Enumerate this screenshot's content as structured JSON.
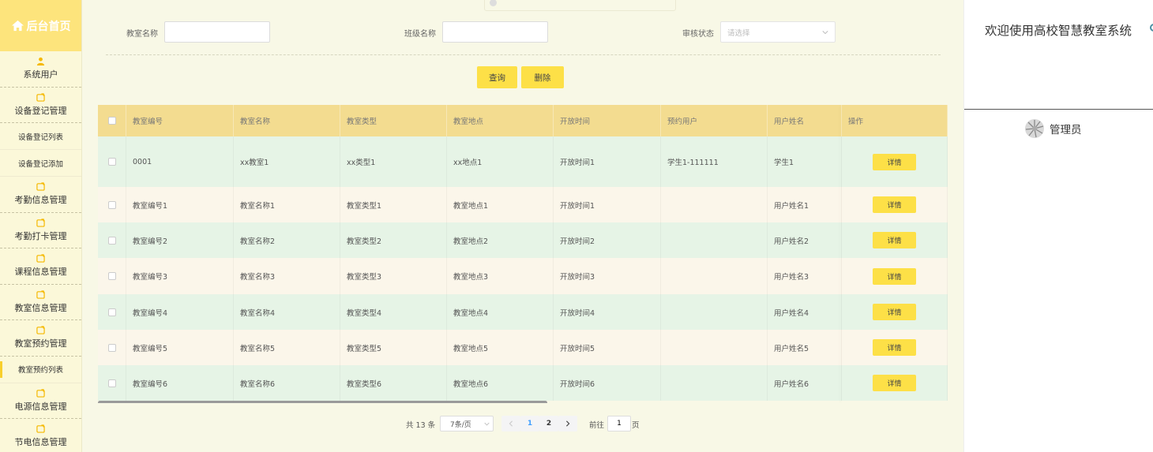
{
  "sidebar": {
    "home_label": "后台首页",
    "items": [
      {
        "label": "系统用户",
        "icon": "user-icon"
      },
      {
        "label": "设备登记管理",
        "icon": "folder-icon"
      },
      {
        "label": "设备登记列表",
        "sub": true
      },
      {
        "label": "设备登记添加",
        "sub": true
      },
      {
        "label": "考勤信息管理",
        "icon": "folder-icon"
      },
      {
        "label": "考勤打卡管理",
        "icon": "folder-icon"
      },
      {
        "label": "课程信息管理",
        "icon": "folder-icon"
      },
      {
        "label": "教室信息管理",
        "icon": "folder-icon"
      },
      {
        "label": "教室预约管理",
        "icon": "folder-icon"
      },
      {
        "label": "教室预约列表",
        "sub": true,
        "active": true
      },
      {
        "label": "电源信息管理",
        "icon": "folder-icon"
      },
      {
        "label": "节电信息管理",
        "icon": "folder-icon"
      }
    ]
  },
  "search": {
    "classroom_label": "教室名称",
    "classroom_value": "",
    "class_label": "班级名称",
    "class_value": "",
    "status_label": "审核状态",
    "status_placeholder": "请选择",
    "query_btn": "查询",
    "delete_btn": "删除"
  },
  "table": {
    "headers": [
      "教室编号",
      "教室名称",
      "教室类型",
      "教室地点",
      "开放时间",
      "预约用户",
      "用户姓名",
      "操作"
    ],
    "detail_label": "详情",
    "rows": [
      [
        "0001",
        "xx教室1",
        "xx类型1",
        "xx地点1",
        "开放时间1",
        "学生1-111111",
        "学生1"
      ],
      [
        "教室编号1",
        "教室名称1",
        "教室类型1",
        "教室地点1",
        "开放时间1",
        "",
        "用户姓名1"
      ],
      [
        "教室编号2",
        "教室名称2",
        "教室类型2",
        "教室地点2",
        "开放时间2",
        "",
        "用户姓名2"
      ],
      [
        "教室编号3",
        "教室名称3",
        "教室类型3",
        "教室地点3",
        "开放时间3",
        "",
        "用户姓名3"
      ],
      [
        "教室编号4",
        "教室名称4",
        "教室类型4",
        "教室地点4",
        "开放时间4",
        "",
        "用户姓名4"
      ],
      [
        "教室编号5",
        "教室名称5",
        "教室类型5",
        "教室地点5",
        "开放时间5",
        "",
        "用户姓名5"
      ],
      [
        "教室编号6",
        "教室名称6",
        "教室类型6",
        "教室地点6",
        "开放时间6",
        "",
        "用户姓名6"
      ]
    ]
  },
  "pagination": {
    "total": "共 13 条",
    "page_size": "7条/页",
    "pages": [
      "1",
      "2"
    ],
    "current_page": "1",
    "goto_label": "前往",
    "goto_value": "1",
    "page_suffix": "页"
  },
  "right_panel": {
    "welcome": "欢迎使用高校智慧教室系统",
    "user_name": "管理员"
  },
  "colors": {
    "accent_yellow": "#fde047",
    "header_yellow": "#f3dc90",
    "row_green": "#e6f4e6",
    "row_cream": "#fbf6ea"
  }
}
